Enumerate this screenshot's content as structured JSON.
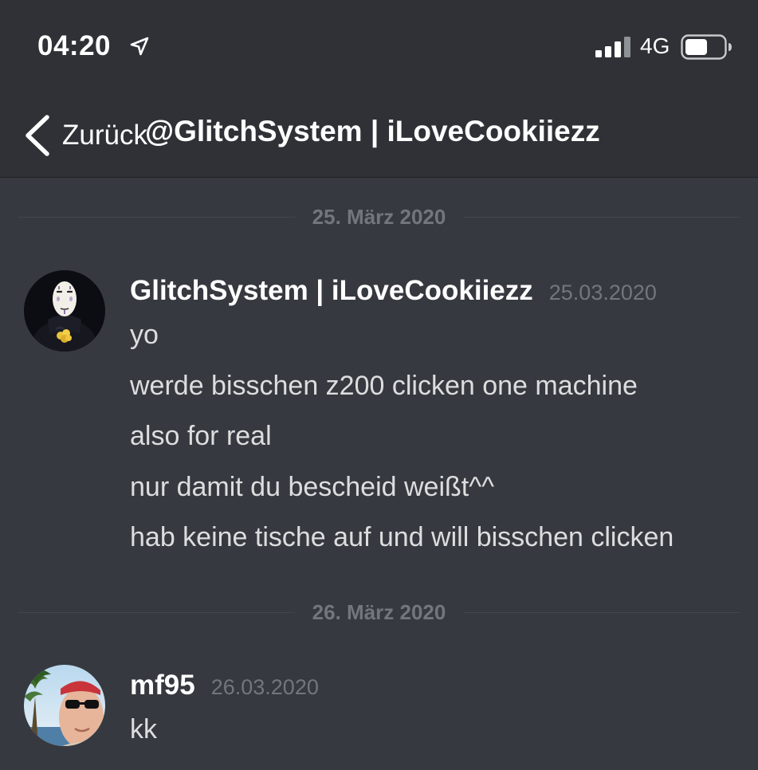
{
  "status_bar": {
    "time": "04:20",
    "location_icon": "location-arrow-icon",
    "signal_icon": "cellular-signal-icon",
    "network": "4G",
    "battery_icon": "battery-icon"
  },
  "header": {
    "back_label": "Zurück",
    "back_icon": "chevron-left-icon",
    "channel_title": "@GlitchSystem | iLoveCookiiezz"
  },
  "colors": {
    "background": "#36393f",
    "header_background": "#2f3136",
    "text_primary": "#ffffff",
    "text_message": "#dcddde",
    "text_muted": "#72767d"
  },
  "dividers": [
    {
      "label": "25. März 2020"
    },
    {
      "label": "26. März 2020"
    }
  ],
  "messages": [
    {
      "author": "GlitchSystem | iLoveCookiiezz",
      "timestamp": "25.03.2020",
      "avatar": "no-face-avatar",
      "lines": [
        "yo",
        "werde bisschen z200 clicken one machine",
        "also for real",
        "nur damit du bescheid weißt^^",
        "hab keine tische auf und will bisschen clicken"
      ]
    },
    {
      "author": "mf95",
      "timestamp": "26.03.2020",
      "avatar": "user-photo-avatar",
      "lines": [
        "kk"
      ]
    }
  ]
}
